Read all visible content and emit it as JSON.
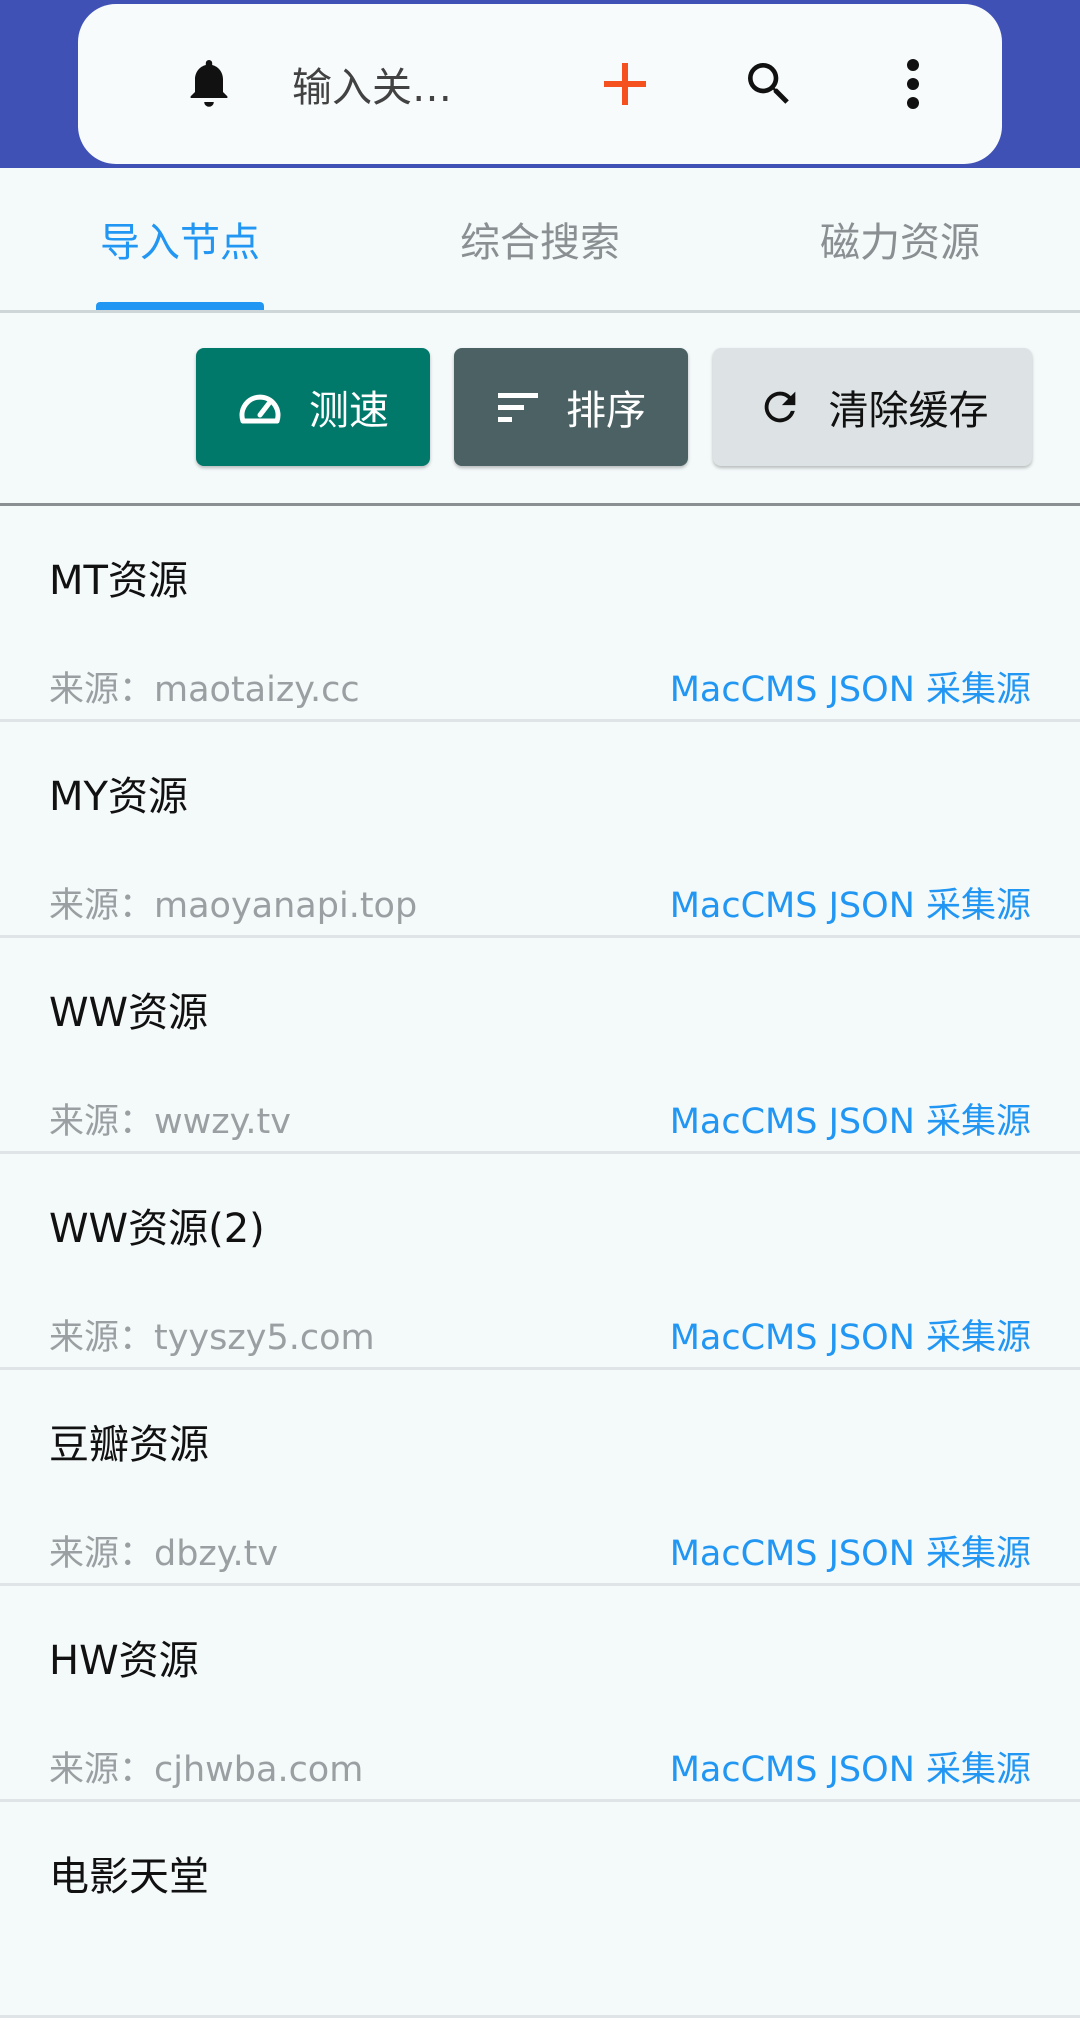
{
  "header": {
    "search_placeholder": "输入关…",
    "icons": {
      "bell": "bell-icon",
      "add": "plus-icon",
      "search": "search-icon",
      "more": "more-vert-icon"
    },
    "colors": {
      "app_bar": "#3f51b5",
      "add_icon": "#f4511e"
    }
  },
  "tabs": [
    {
      "label": "导入节点",
      "active": true
    },
    {
      "label": "综合搜索",
      "active": false
    },
    {
      "label": "磁力资源",
      "active": false
    }
  ],
  "toolbar": {
    "speed_label": "测速",
    "sort_label": "排序",
    "clear_label": "清除缓存",
    "icons": {
      "speed": "speedometer-icon",
      "sort": "sort-icon",
      "clear": "refresh-icon"
    }
  },
  "sources": [
    {
      "name": "MT资源",
      "source": "来源：maotaizy.cc",
      "type": "MacCMS JSON 采集源"
    },
    {
      "name": "MY资源",
      "source": "来源：maoyanapi.top",
      "type": "MacCMS JSON 采集源"
    },
    {
      "name": "WW资源",
      "source": "来源：wwzy.tv",
      "type": "MacCMS JSON 采集源"
    },
    {
      "name": "WW资源(2)",
      "source": "来源：tyyszy5.com",
      "type": "MacCMS JSON 采集源"
    },
    {
      "name": "豆瓣资源",
      "source": "来源：dbzy.tv",
      "type": "MacCMS JSON 采集源"
    },
    {
      "name": "HW资源",
      "source": "来源：cjhwba.com",
      "type": "MacCMS JSON 采集源"
    },
    {
      "name": "电影天堂",
      "source": "",
      "type": ""
    }
  ]
}
